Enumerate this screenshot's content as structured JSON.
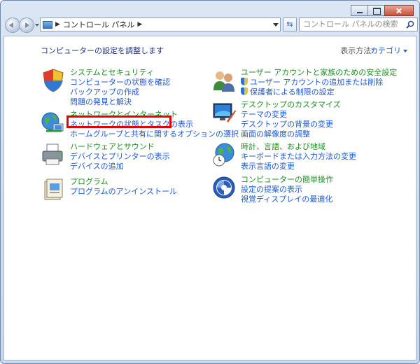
{
  "address": {
    "label": "コントロール パネル"
  },
  "search": {
    "placeholder": "コントロール パネルの検索"
  },
  "heading": "コンピューターの設定を調整します",
  "view_by": {
    "label": "表示方法:",
    "value": "カテゴリ"
  },
  "categories": {
    "system": {
      "title": "システムとセキュリティ",
      "links": [
        "コンピューターの状態を確認",
        "バックアップの作成",
        "問題の発見と解決"
      ]
    },
    "network": {
      "title": "ネットワークとインターネット",
      "links": [
        "ネットワークの状態とタスクの表示",
        "ホームグループと共有に関するオプションの選択"
      ]
    },
    "hardware": {
      "title": "ハードウェアとサウンド",
      "links": [
        "デバイスとプリンターの表示",
        "デバイスの追加"
      ]
    },
    "programs": {
      "title": "プログラム",
      "links": [
        "プログラムのアンインストール"
      ]
    },
    "users": {
      "title": "ユーザー アカウントと家族のための安全設定",
      "links": [
        "ユーザー アカウントの追加または削除",
        "保護者による制限の設定"
      ]
    },
    "appearance": {
      "title": "デスクトップのカスタマイズ",
      "links": [
        "テーマの変更",
        "デスクトップの背景の変更",
        "画面の解像度の調整"
      ]
    },
    "clock": {
      "title": "時計、言語、および地域",
      "links": [
        "キーボードまたは入力方法の変更",
        "表示言語の変更"
      ]
    },
    "ease": {
      "title": "コンピューターの簡単操作",
      "links": [
        "設定の提案の表示",
        "視覚ディスプレイの最適化"
      ]
    }
  },
  "colors": {
    "category_title": "#1b8f20",
    "link": "#1e5ad6",
    "highlight": "#e00000"
  }
}
